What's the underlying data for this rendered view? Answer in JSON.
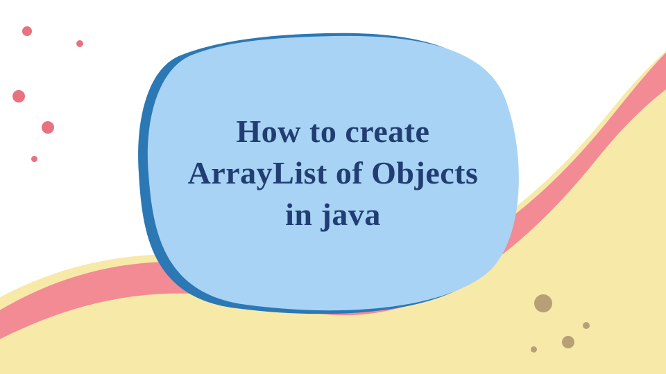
{
  "title": {
    "line1": "How to create",
    "line2": "ArrayList of Objects",
    "line3": "in java"
  },
  "palette": {
    "bg": "#ffffff",
    "yellow": "#f7e9a8",
    "pink": "#f28b94",
    "blob_back": "#2b78b5",
    "blob_front": "#a8d3f4",
    "text": "#213e73",
    "dot_pink": "#e8727f",
    "dot_brown": "#b7a076"
  }
}
